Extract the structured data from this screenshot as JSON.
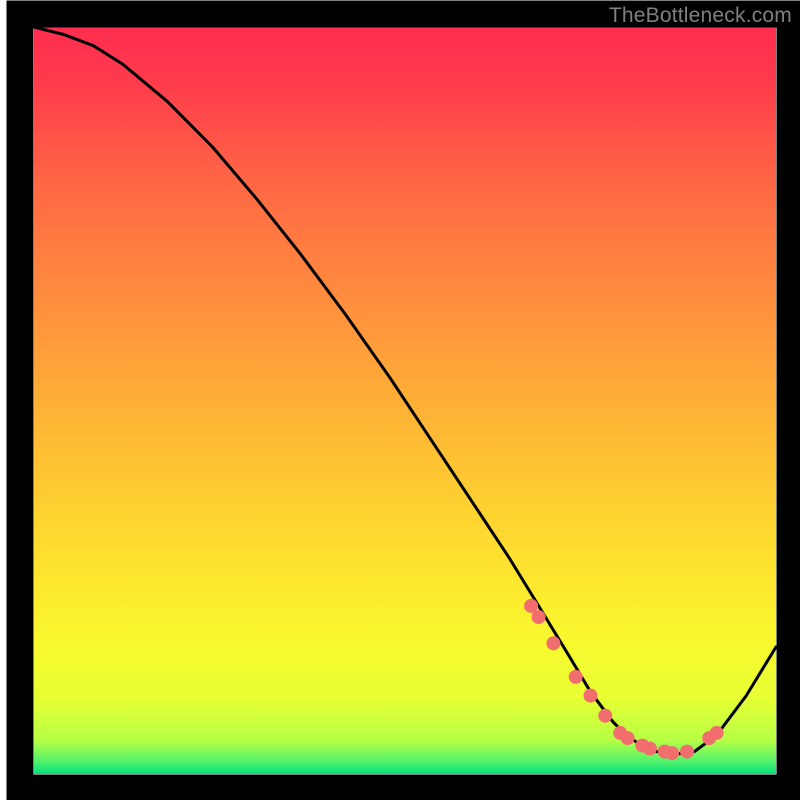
{
  "watermark": "TheBottleneck.com",
  "chart_data": {
    "type": "line",
    "title": "",
    "xlabel": "",
    "ylabel": "",
    "xlim": [
      0,
      100
    ],
    "ylim": [
      0,
      100
    ],
    "background_gradient": {
      "top_color": "#ff2d4f",
      "mid_upper_color": "#ff8b3e",
      "mid_color": "#fede2f",
      "mid_lower_color": "#f6ff33",
      "bottom_color": "#00e27a"
    },
    "series": [
      {
        "name": "curve",
        "color": "#000000",
        "x": [
          0,
          4,
          8,
          12,
          18,
          24,
          30,
          36,
          42,
          48,
          54,
          60,
          64,
          68,
          72,
          75,
          78,
          80,
          83,
          86,
          89,
          92,
          96,
          100
        ],
        "y": [
          100,
          99,
          97.5,
          95,
          90,
          84,
          77,
          69.5,
          61.5,
          53,
          44,
          35,
          29,
          22.5,
          16,
          11,
          7,
          5,
          3.2,
          2.6,
          3.0,
          5.2,
          10.5,
          17
        ]
      },
      {
        "name": "low-region-marker",
        "color": "#f26d6d",
        "type": "scatter",
        "x": [
          67,
          68,
          70,
          73,
          75,
          77,
          79,
          80,
          82,
          83,
          85,
          86,
          88,
          91,
          92
        ],
        "y": [
          22.5,
          21,
          17.5,
          13,
          10.5,
          7.8,
          5.5,
          4.8,
          3.8,
          3.4,
          3.0,
          2.8,
          3.0,
          4.8,
          5.5
        ]
      }
    ],
    "annotations": []
  }
}
